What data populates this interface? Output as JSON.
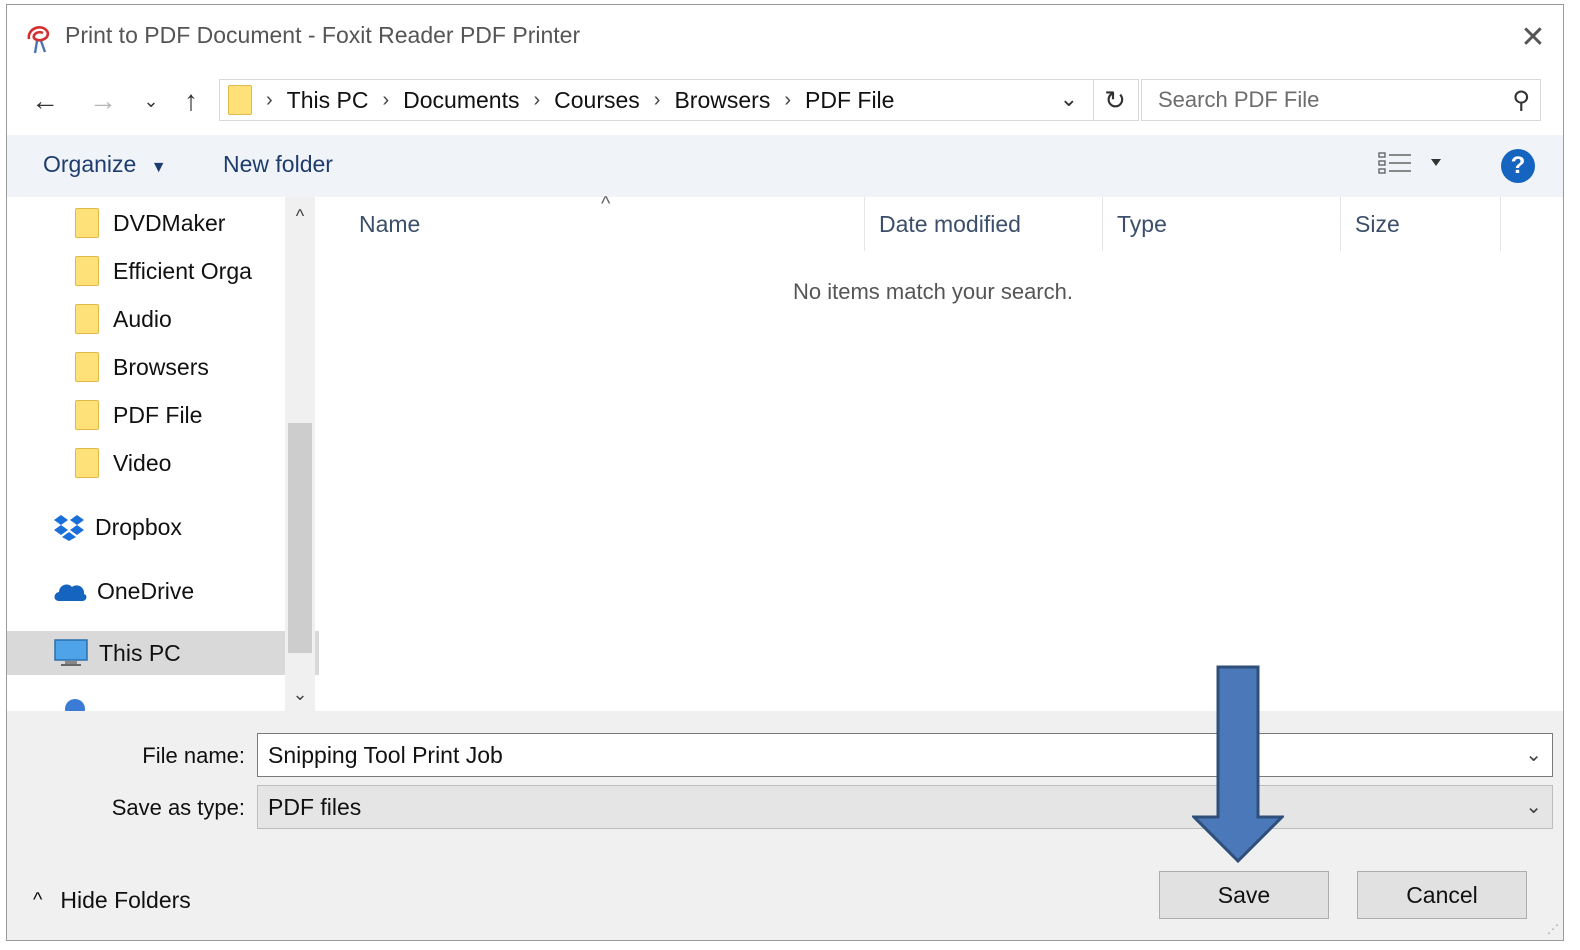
{
  "window": {
    "title": "Print to PDF Document - Foxit Reader PDF Printer"
  },
  "nav": {
    "breadcrumb": [
      "This PC",
      "Documents",
      "Courses",
      "Browsers",
      "PDF File"
    ],
    "search_placeholder": "Search PDF File"
  },
  "toolbar": {
    "organize": "Organize",
    "new_folder": "New folder"
  },
  "sidebar": {
    "items": [
      {
        "label": "DVDMaker",
        "pinned": true
      },
      {
        "label": "Efficient Orga",
        "pinned": true
      },
      {
        "label": "Audio"
      },
      {
        "label": "Browsers"
      },
      {
        "label": "PDF File"
      },
      {
        "label": "Video"
      },
      {
        "label": "Dropbox"
      },
      {
        "label": "OneDrive"
      },
      {
        "label": "This PC",
        "selected": true
      }
    ]
  },
  "list": {
    "columns": [
      "Name",
      "Date modified",
      "Type",
      "Size"
    ],
    "empty_message": "No items match your search."
  },
  "form": {
    "file_name_label": "File name:",
    "file_name_value": "Snipping Tool Print Job",
    "save_type_label": "Save as type:",
    "save_type_value": "PDF files"
  },
  "footer": {
    "hide_folders": "Hide Folders",
    "save": "Save",
    "cancel": "Cancel"
  },
  "colors": {
    "arrow_fill": "#4a78b8",
    "arrow_stroke": "#2f4f7a",
    "help": "#1565c0",
    "folder": "#ffe17a"
  }
}
